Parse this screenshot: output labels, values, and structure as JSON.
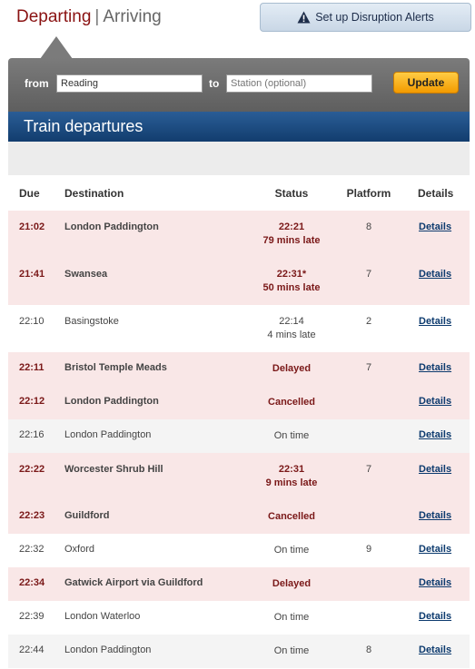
{
  "tabs": {
    "departing": "Departing",
    "separator": "|",
    "arriving": "Arriving"
  },
  "alerts_button": {
    "label": "Set up Disruption Alerts",
    "icon": "warning-icon"
  },
  "search": {
    "from_label": "from",
    "from_value": "Reading",
    "to_label": "to",
    "to_placeholder": "Station (optional)",
    "update_label": "Update"
  },
  "board": {
    "title": "Train departures"
  },
  "columns": {
    "due": "Due",
    "destination": "Destination",
    "status": "Status",
    "platform": "Platform",
    "details": "Details"
  },
  "rows": [
    {
      "due": "21:02",
      "destination": "London Paddington",
      "status": "22:21",
      "status_note": "79 mins late",
      "platform": "8",
      "details": "Details"
    },
    {
      "due": "21:41",
      "destination": "Swansea",
      "status": "22:31*",
      "status_note": "50 mins late",
      "platform": "7",
      "details": "Details"
    },
    {
      "due": "22:10",
      "destination": "Basingstoke",
      "status": "22:14",
      "status_note": "4 mins late",
      "platform": "2",
      "details": "Details"
    },
    {
      "due": "22:11",
      "destination": "Bristol Temple Meads",
      "status": "Delayed",
      "status_note": "",
      "platform": "7",
      "details": "Details"
    },
    {
      "due": "22:12",
      "destination": "London Paddington",
      "status": "Cancelled",
      "status_note": "",
      "platform": "",
      "details": "Details"
    },
    {
      "due": "22:16",
      "destination": "London Paddington",
      "status": "On time",
      "status_note": "",
      "platform": "",
      "details": "Details"
    },
    {
      "due": "22:22",
      "destination": "Worcester Shrub Hill",
      "status": "22:31",
      "status_note": "9 mins late",
      "platform": "7",
      "details": "Details"
    },
    {
      "due": "22:23",
      "destination": "Guildford",
      "status": "Cancelled",
      "status_note": "",
      "platform": "",
      "details": "Details"
    },
    {
      "due": "22:32",
      "destination": "Oxford",
      "status": "On time",
      "status_note": "",
      "platform": "9",
      "details": "Details"
    },
    {
      "due": "22:34",
      "destination": "Gatwick Airport via Guildford",
      "status": "Delayed",
      "status_note": "",
      "platform": "",
      "details": "Details"
    },
    {
      "due": "22:39",
      "destination": "London Waterloo",
      "status": "On time",
      "status_note": "",
      "platform": "",
      "details": "Details"
    },
    {
      "due": "22:44",
      "destination": "London Paddington",
      "status": "On time",
      "status_note": "",
      "platform": "8",
      "details": "Details"
    }
  ],
  "colors": {
    "accent": "#8a1212",
    "header_blue": "#1a4a82",
    "problem_row": "#f9e7e7",
    "update_button": "#f7a800"
  }
}
